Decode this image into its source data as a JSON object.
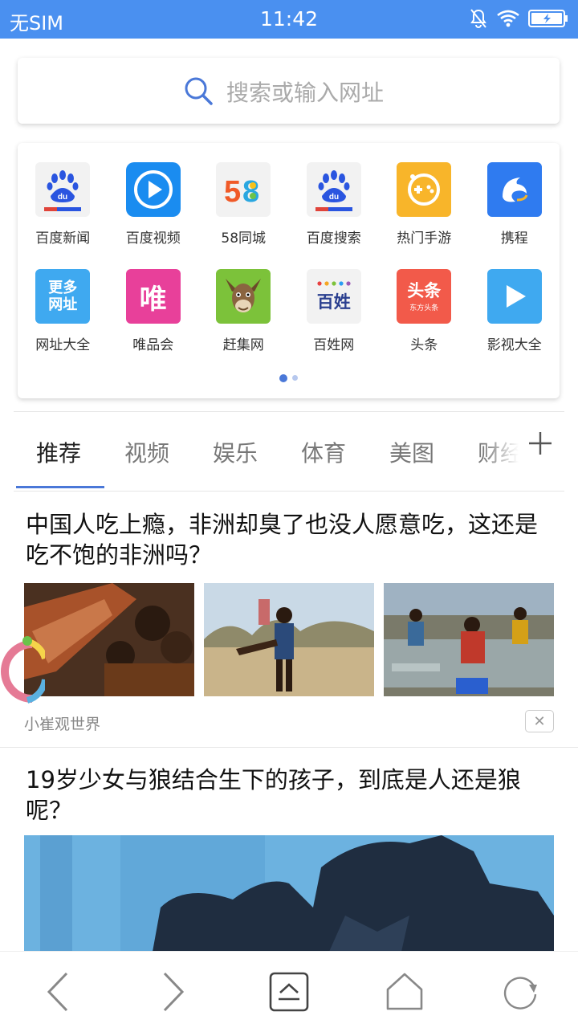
{
  "status_bar": {
    "carrier": "无SIM",
    "time": "11:42",
    "icons": [
      "bell-off-icon",
      "wifi-icon",
      "battery-charging-icon"
    ]
  },
  "search": {
    "placeholder": "搜索或输入网址"
  },
  "shortcuts": {
    "items": [
      {
        "label": "百度新闻",
        "icon": "baidu-icon"
      },
      {
        "label": "百度视频",
        "icon": "baidu-video-icon"
      },
      {
        "label": "58同城",
        "icon": "58-icon"
      },
      {
        "label": "百度搜索",
        "icon": "baidu-icon"
      },
      {
        "label": "热门手游",
        "icon": "gamepad-icon"
      },
      {
        "label": "携程",
        "icon": "dolphin-icon"
      },
      {
        "label": "网址大全",
        "icon": "more-sites-icon",
        "text": "更多网址"
      },
      {
        "label": "唯品会",
        "icon": "vip-icon",
        "text": "唯"
      },
      {
        "label": "赶集网",
        "icon": "donkey-icon"
      },
      {
        "label": "百姓网",
        "icon": "baixing-icon",
        "text": "百姓"
      },
      {
        "label": "头条",
        "icon": "toutiao-icon",
        "text": "头条",
        "subtext": "东方头条"
      },
      {
        "label": "影视大全",
        "icon": "play-icon"
      }
    ],
    "page_dots": 2,
    "active_page": 1
  },
  "tabs": [
    {
      "label": "推荐",
      "active": true
    },
    {
      "label": "视频",
      "active": false
    },
    {
      "label": "娱乐",
      "active": false
    },
    {
      "label": "体育",
      "active": false
    },
    {
      "label": "美图",
      "active": false
    },
    {
      "label": "财经",
      "active": false
    }
  ],
  "articles": [
    {
      "title": "中国人吃上瘾，非洲却臭了也没人愿意吃，这还是吃不饱的非洲吗？",
      "source": "小崔观世界",
      "close_label": "✕"
    },
    {
      "title": "19岁少女与狼结合生下的孩子，到底是人还是狼呢？"
    }
  ],
  "colors": {
    "status_bar": "#4a90f0",
    "accent": "#4a78d8"
  },
  "bottom_nav": [
    "back-icon",
    "forward-icon",
    "menu-icon",
    "home-icon",
    "refresh-icon"
  ]
}
